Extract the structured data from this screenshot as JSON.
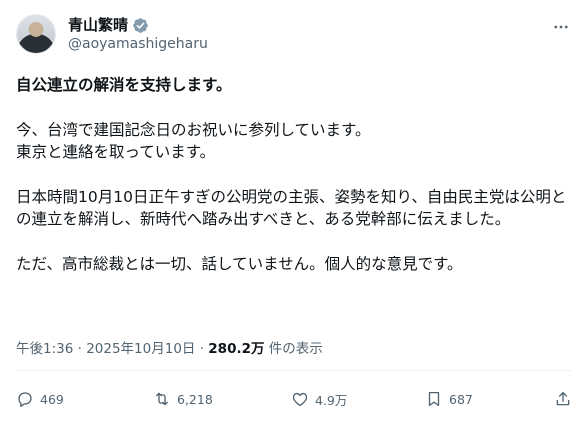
{
  "post": {
    "author": {
      "display_name": "青山繁晴",
      "handle": "@aoyamashigeharu"
    },
    "headline": "自公連立の解消を支持します。",
    "paragraphs": [
      "今、台湾で建国記念日のお祝いに参列しています。\n東京と連絡を取っています。",
      "日本時間10月10日正午すぎの公明党の主張、姿勢を知り、自由民主党は公明との連立を解消し、新時代へ踏み出すべきと、ある党幹部に伝えました。",
      "ただ、高市総裁とは一切、話していません。個人的な意見です。"
    ],
    "timestamp": "午後1:36 · 2025年10月10日 · ",
    "views_count": "280.2万",
    "views_label": " 件の表示"
  },
  "actions": {
    "reply_count": "469",
    "repost_count": "6,218",
    "like_count": "4.9万",
    "bookmark_count": "687"
  },
  "icons": {
    "verified": "verified-badge-icon",
    "more": "more-options-icon",
    "reply": "reply-icon",
    "repost": "repost-icon",
    "like": "like-icon",
    "bookmark": "bookmark-icon",
    "share": "share-icon"
  },
  "colors": {
    "text": "#0f1419",
    "secondary": "#536471",
    "verified": "#829aab"
  }
}
